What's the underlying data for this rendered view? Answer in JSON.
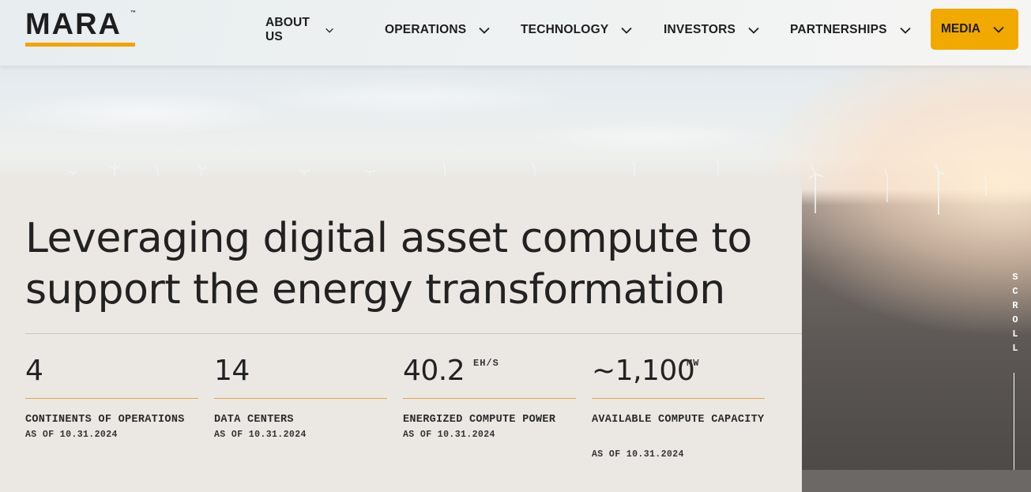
{
  "brand": {
    "name": "MARA",
    "trademark": "™",
    "accent_color": "#f1a900"
  },
  "nav": {
    "items": [
      {
        "label": "ABOUT US"
      },
      {
        "label": "OPERATIONS"
      },
      {
        "label": "TECHNOLOGY"
      },
      {
        "label": "INVESTORS"
      },
      {
        "label": "PARTNERSHIPS"
      }
    ],
    "media_button": "MEDIA"
  },
  "hero": {
    "headline": "Leveraging digital asset compute to support the energy transformation"
  },
  "stats": [
    {
      "value": "4",
      "unit": "",
      "label": "CONTINENTS OF OPERATIONS",
      "date": "AS OF 10.31.2024"
    },
    {
      "value": "14",
      "unit": "",
      "label": "DATA CENTERS",
      "date": "AS OF 10.31.2024"
    },
    {
      "value": "40.2",
      "unit": "EH/S",
      "label": "ENERGIZED COMPUTE POWER",
      "date": "AS OF 10.31.2024"
    },
    {
      "value": "~1,100",
      "unit": "MW",
      "label": "AVAILABLE COMPUTE CAPACITY",
      "date": "AS OF 10.31.2024"
    }
  ],
  "scroll": {
    "label": "SCROLL"
  }
}
